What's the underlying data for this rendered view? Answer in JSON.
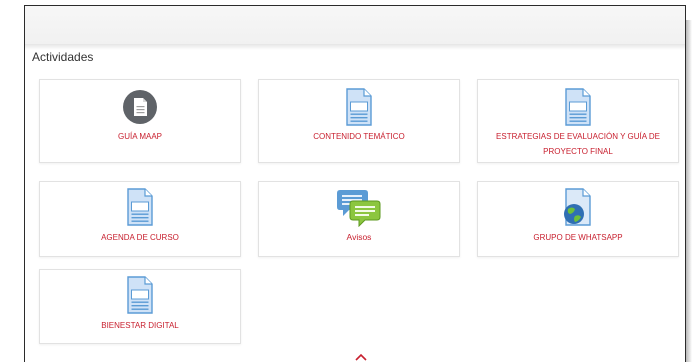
{
  "section": {
    "title": "Actividades"
  },
  "activities": [
    {
      "label": "GUÍA MAAP",
      "icon": "document-circle-icon"
    },
    {
      "label": "CONTENIDO TEMÁTICO",
      "icon": "document-icon"
    },
    {
      "label": "ESTRATEGIAS DE EVALUACIÓN Y GUÍA DE PROYECTO FINAL",
      "icon": "document-icon"
    },
    {
      "label": "AGENDA DE CURSO",
      "icon": "document-icon"
    },
    {
      "label": "Avisos",
      "icon": "forum-chat-icon"
    },
    {
      "label": "GRUPO DE WHATSAPP",
      "icon": "url-globe-icon"
    },
    {
      "label": "BIENESTAR DIGITAL",
      "icon": "document-icon"
    }
  ],
  "colors": {
    "label": "#c8202f",
    "doc_blue": "#5b9bd5",
    "chat_green": "#8cc63f"
  },
  "footer": {
    "icon": "chevron-up-icon"
  }
}
